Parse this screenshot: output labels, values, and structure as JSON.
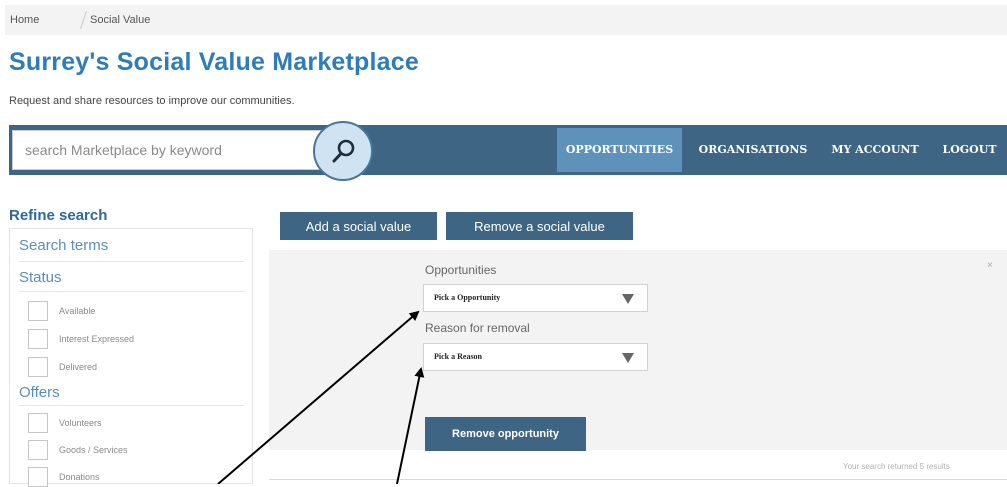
{
  "breadcrumb": {
    "home": "Home",
    "current": "Social Value"
  },
  "header": {
    "title": "Surrey's Social Value Marketplace",
    "subtitle": "Request and share resources to improve our communities."
  },
  "search": {
    "placeholder": "search Marketplace by keyword"
  },
  "nav": {
    "items": [
      {
        "label": "OPPORTUNITIES",
        "active": true
      },
      {
        "label": "ORGANISATIONS",
        "active": false
      },
      {
        "label": "MY ACCOUNT",
        "active": false
      },
      {
        "label": "LOGOUT",
        "active": false
      }
    ]
  },
  "sidebar": {
    "title": "Refine search",
    "search_terms": "Search terms",
    "status": {
      "heading": "Status",
      "options": [
        "Available",
        "Interest Expressed",
        "Delivered"
      ]
    },
    "offers": {
      "heading": "Offers",
      "options": [
        "Volunteers",
        "Goods / Services",
        "Donations"
      ]
    }
  },
  "actions": {
    "add_label": "Add a social value",
    "remove_label": "Remove a social value"
  },
  "form": {
    "opportunities_label": "Opportunities",
    "opportunity_select": "Pick a Opportunity",
    "reason_label": "Reason for removal",
    "reason_select": "Pick a Reason",
    "submit_label": "Remove opportunity",
    "close_glyph": "×"
  },
  "results": {
    "text": "Your search returned 5 results"
  },
  "colors": {
    "brand_dark": "#3e6584",
    "brand_active": "#5f92bb",
    "title_blue": "#2e7db8",
    "search_circle": "#cfe3f2"
  },
  "icons": {
    "search": "magnifier-icon",
    "close": "close-icon",
    "dropdown": "triangle-down-icon"
  }
}
